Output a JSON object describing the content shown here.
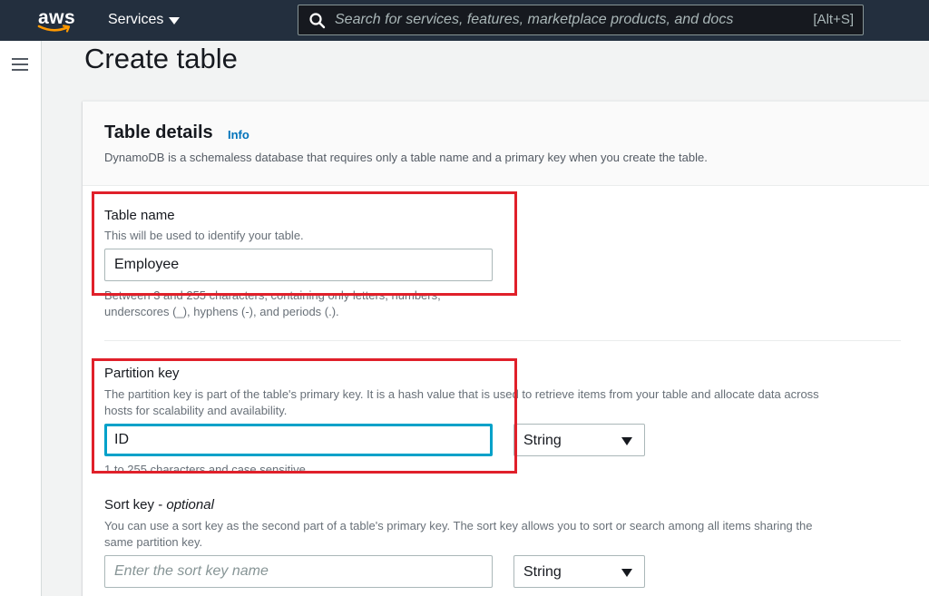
{
  "topnav": {
    "logo_text": "aws",
    "services_label": "Services",
    "search_placeholder": "Search for services, features, marketplace products, and docs",
    "search_shortcut": "[Alt+S]"
  },
  "page": {
    "title": "Create table"
  },
  "table_details": {
    "heading": "Table details",
    "info_link": "Info",
    "description": "DynamoDB is a schemaless database that requires only a table name and a primary key when you create the table."
  },
  "table_name": {
    "label": "Table name",
    "description": "This will be used to identify your table.",
    "value": "Employee",
    "constraint_line1": "Between 3 and 255 characters, containing only letters, numbers,",
    "constraint_line2": "underscores (_), hyphens (-), and periods (.)."
  },
  "partition_key": {
    "label": "Partition key",
    "description_line1": "The partition key is part of the table's primary key. It is a hash value that is used to retrieve items from your table and allocate data across",
    "description_line2": "hosts for scalability and availability.",
    "value": "ID",
    "type_value": "String",
    "constraint": "1 to 255 characters and case sensitive."
  },
  "sort_key": {
    "label": "Sort key",
    "label_optional": "optional",
    "description_line1": "You can use a sort key as the second part of a table's primary key. The sort key allows you to sort or search among all items sharing the",
    "description_line2": "same partition key.",
    "placeholder": "Enter the sort key name",
    "type_value": "String"
  },
  "colors": {
    "nav_bg": "#232f3e",
    "link": "#0073bb",
    "focus": "#00a1c9",
    "highlight": "#e0202a",
    "logo_smile": "#ff9900"
  },
  "icons": [
    "aws-logo-icon",
    "caret-down-icon",
    "search-icon",
    "hamburger-menu-icon",
    "select-caret-icon"
  ]
}
